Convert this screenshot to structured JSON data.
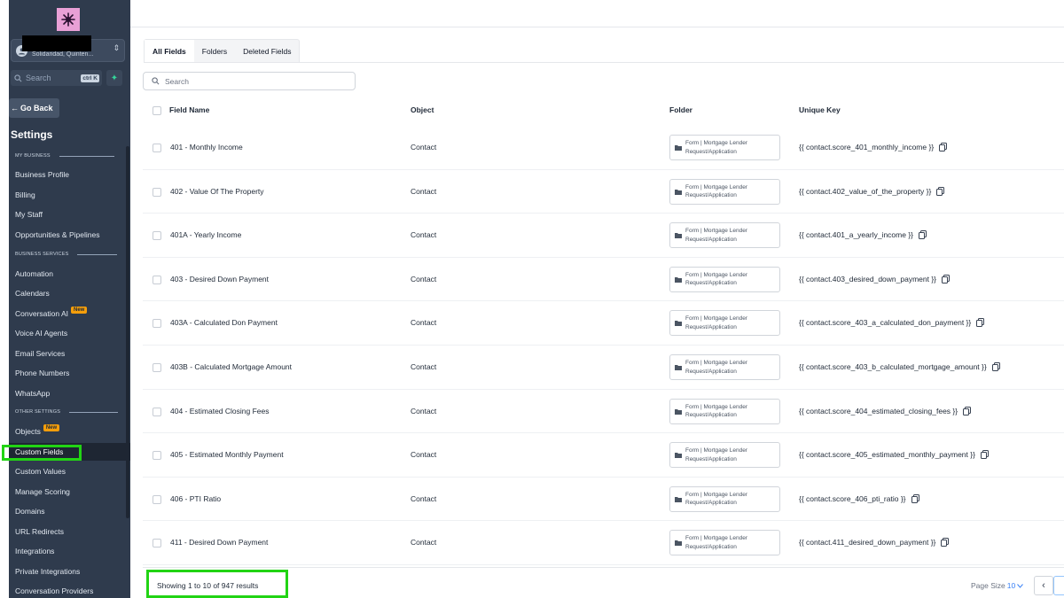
{
  "sidebar": {
    "account": {
      "subtitle": "Solidaridad, Quinten..."
    },
    "search": {
      "placeholder": "Search",
      "shortcut": "ctrl K"
    },
    "go_back": "Go Back",
    "title": "Settings",
    "sections": [
      {
        "label": "MY BUSINESS",
        "items": [
          "Business Profile",
          "Billing",
          "My Staff",
          "Opportunities & Pipelines"
        ]
      },
      {
        "label": "BUSINESS SERVICES",
        "items": [
          "Automation",
          "Calendars",
          "Conversation AI",
          "Voice AI Agents",
          "Email Services",
          "Phone Numbers",
          "WhatsApp"
        ]
      },
      {
        "label": "OTHER SETTINGS",
        "items": [
          "Objects",
          "Custom Fields",
          "Custom Values",
          "Manage Scoring",
          "Domains",
          "URL Redirects",
          "Integrations",
          "Private Integrations",
          "Conversation Providers"
        ]
      }
    ],
    "new_badge": "New",
    "active_item": "Custom Fields"
  },
  "tabs": [
    {
      "label": "All Fields",
      "active": true
    },
    {
      "label": "Folders",
      "active": false
    },
    {
      "label": "Deleted Fields",
      "active": false
    }
  ],
  "field_search": {
    "placeholder": "Search"
  },
  "table": {
    "headers": {
      "name": "Field Name",
      "object": "Object",
      "folder": "Folder",
      "key": "Unique Key"
    },
    "rows": [
      {
        "name": "401 - Monthly Income",
        "object": "Contact",
        "folder": "Form | Mortgage Lender Request/Application",
        "key": "{{ contact.score_401_monthly_income }}"
      },
      {
        "name": "402 - Value Of The Property",
        "object": "Contact",
        "folder": "Form | Mortgage Lender Request/Application",
        "key": "{{ contact.402_value_of_the_property }}"
      },
      {
        "name": "401A - Yearly Income",
        "object": "Contact",
        "folder": "Form | Mortgage Lender Request/Application",
        "key": "{{ contact.401_a_yearly_income }}"
      },
      {
        "name": "403 - Desired Down Payment",
        "object": "Contact",
        "folder": "Form | Mortgage Lender Request/Application",
        "key": "{{ contact.403_desired_down_payment }}"
      },
      {
        "name": "403A - Calculated Don Payment",
        "object": "Contact",
        "folder": "Form | Mortgage Lender Request/Application",
        "key": "{{ contact.score_403_a_calculated_don_payment }}"
      },
      {
        "name": "403B - Calculated Mortgage Amount",
        "object": "Contact",
        "folder": "Form | Mortgage Lender Request/Application",
        "key": "{{ contact.score_403_b_calculated_mortgage_amount }}"
      },
      {
        "name": "404 - Estimated Closing Fees",
        "object": "Contact",
        "folder": "Form | Mortgage Lender Request/Application",
        "key": "{{ contact.score_404_estimated_closing_fees }}"
      },
      {
        "name": "405 - Estimated Monthly Payment",
        "object": "Contact",
        "folder": "Form | Mortgage Lender Request/Application",
        "key": "{{ contact.score_405_estimated_monthly_payment }}"
      },
      {
        "name": "406 - PTI Ratio",
        "object": "Contact",
        "folder": "Form | Mortgage Lender Request/Application",
        "key": "{{ contact.score_406_pti_ratio }}"
      },
      {
        "name": "411 - Desired Down Payment",
        "object": "Contact",
        "folder": "Form | Mortgage Lender Request/Application",
        "key": "{{ contact.411_desired_down_payment }}"
      }
    ]
  },
  "footer": {
    "results": "Showing 1 to 10 of 947 results",
    "page_size_label": "Page Size",
    "page_size_value": "10"
  },
  "colors": {
    "sidebar_bg": "#2f3b4d",
    "highlight": "#22d414",
    "accent": "#3b82f6",
    "new_badge": "#f59e0b"
  }
}
